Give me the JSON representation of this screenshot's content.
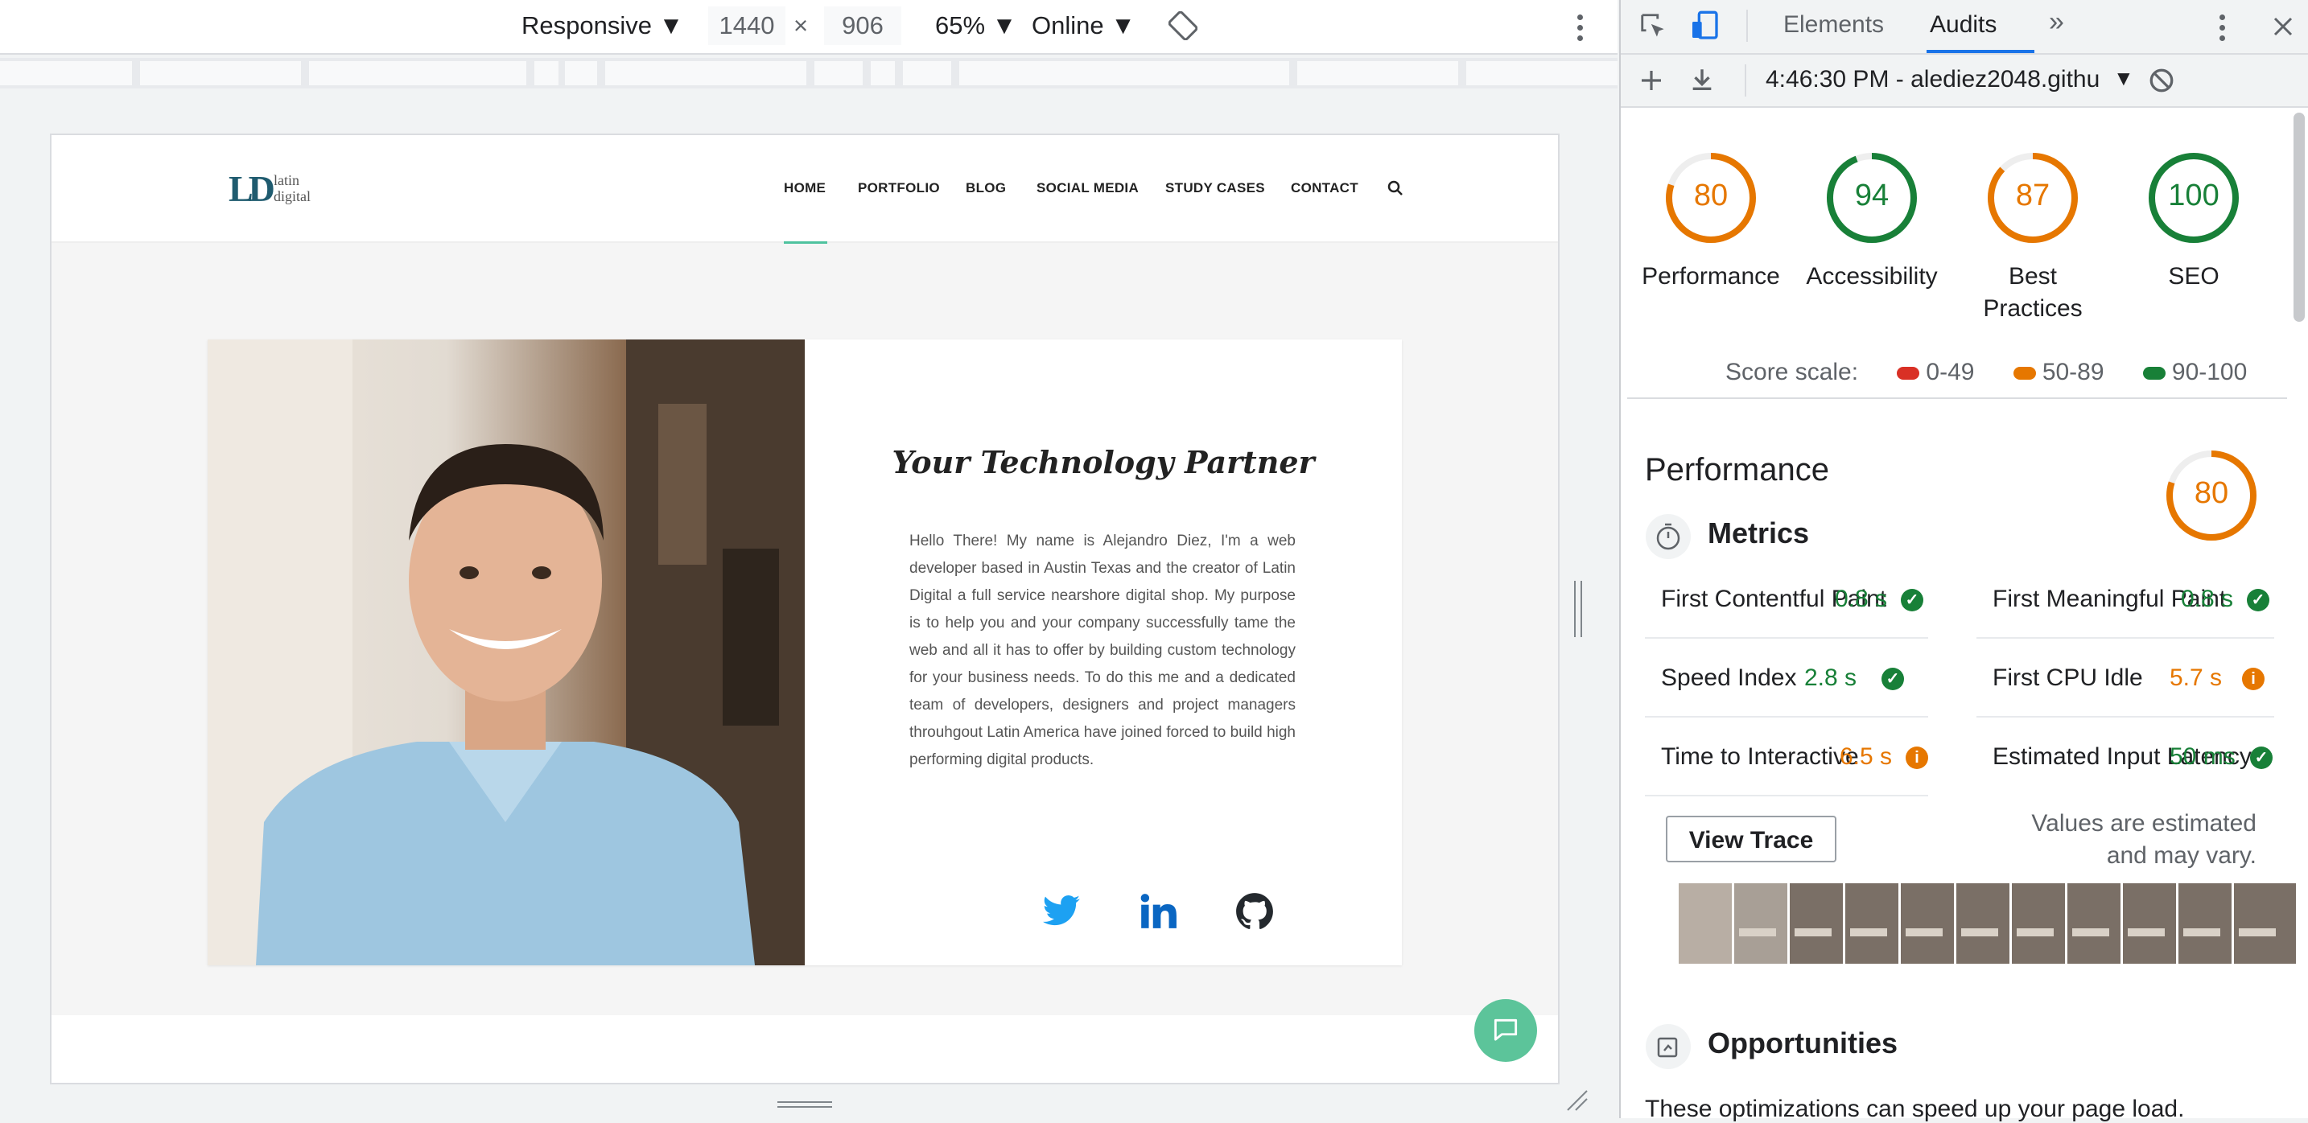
{
  "device_toolbar": {
    "device": "Responsive",
    "width": "1440",
    "times": "×",
    "height": "906",
    "zoom": "65%",
    "throttling": "Online"
  },
  "site": {
    "logo_mark": "LD",
    "logo_line1": "latin",
    "logo_line2": "digital",
    "nav": [
      "HOME",
      "PORTFOLIO",
      "BLOG",
      "SOCIAL MEDIA",
      "STUDY CASES",
      "CONTACT"
    ],
    "hero_title": "Your Technology Partner",
    "hero_body": "Hello There! My name is Alejandro Diez, I'm a web developer based in Austin Texas and the creator of Latin Digital a full service nearshore digital shop. My purpose is to help you and your company successfully tame the web and all it has to offer by building custom technology for your business needs. To do this me and a dedicated team of developers, designers and project managers throuhgout Latin America have joined forced to build high performing digital products.",
    "brand_color": "#1f5b6f",
    "accent_color": "#4ec29e"
  },
  "devtools": {
    "tabs": [
      "Elements",
      "Audits"
    ],
    "more_tabs": "»",
    "report": "4:46:30 PM - alediez2048.githu",
    "gauges": [
      {
        "label_line1": "Performance",
        "label_line2": "",
        "score": 80,
        "color": "#e67700"
      },
      {
        "label_line1": "Accessibility",
        "label_line2": "",
        "score": 94,
        "color": "#188038"
      },
      {
        "label_line1": "Best",
        "label_line2": "Practices",
        "score": 87,
        "color": "#e67700"
      },
      {
        "label_line1": "SEO",
        "label_line2": "",
        "score": 100,
        "color": "#188038"
      }
    ],
    "score_scale": {
      "label": "Score scale:",
      "ranges": [
        {
          "text": "0-49",
          "color": "#d93025"
        },
        {
          "text": "50-89",
          "color": "#e67700"
        },
        {
          "text": "90-100",
          "color": "#188038"
        }
      ]
    },
    "performance": {
      "title": "Performance",
      "score": 80,
      "metrics_title": "Metrics",
      "metrics": [
        {
          "label": "First Contentful Paint",
          "value": "0.8 s",
          "status": "pass"
        },
        {
          "label": "First Meaningful Paint",
          "value": "0.8 s",
          "status": "pass"
        },
        {
          "label": "Speed Index",
          "value": "2.8 s",
          "status": "pass"
        },
        {
          "label": "First CPU Idle",
          "value": "5.7 s",
          "status": "average"
        },
        {
          "label": "Time to Interactive",
          "value": "6.5 s",
          "status": "average"
        },
        {
          "label": "Estimated Input Latency",
          "value": "50 ms",
          "status": "pass"
        }
      ],
      "view_trace": "View Trace",
      "estimate_note_line1": "Values are estimated",
      "estimate_note_line2": "and may vary.",
      "opportunities_title": "Opportunities",
      "opportunities_desc": "These optimizations can speed up your page load."
    }
  }
}
